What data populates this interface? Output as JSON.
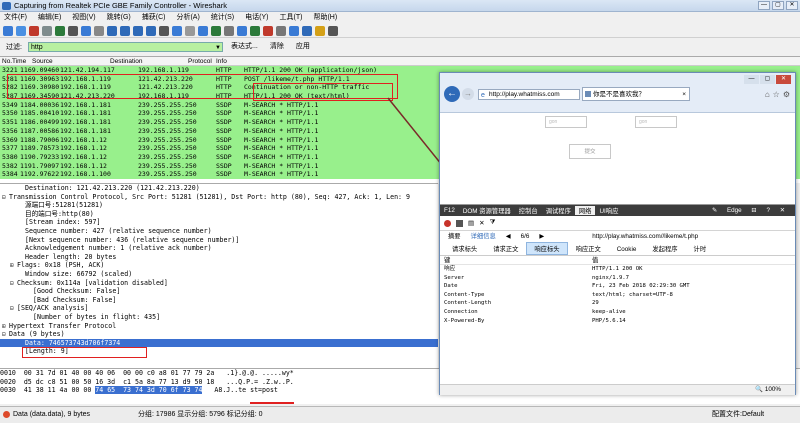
{
  "window": {
    "title": "Capturing from Realtek PCIe GBE Family Controller - Wireshark",
    "controls": [
      "—",
      "▢",
      "✕"
    ]
  },
  "menu": [
    "文件(F)",
    "编辑(E)",
    "视图(V)",
    "跳转(G)",
    "捕获(C)",
    "分析(A)",
    "统计(S)",
    "电话(Y)",
    "工具(T)",
    "帮助(H)"
  ],
  "filter": {
    "label": "过滤:",
    "value": "http",
    "buttons": [
      "表达式...",
      "清除",
      "应用"
    ]
  },
  "packet_list": {
    "headers": [
      "No.",
      "Time",
      "Source",
      "Destination",
      "Protocol",
      "Info"
    ],
    "rows": [
      {
        "no": "3221",
        "time": "1169.09460",
        "src": "121.42.194.117",
        "dst": "192.168.1.119",
        "proto": "HTTP",
        "info": "HTTP/1.1 200 OK  (application/json)",
        "bg": "#98f08c"
      },
      {
        "no": "5281",
        "time": "1169.30963",
        "src": "192.168.1.119",
        "dst": "121.42.213.220",
        "proto": "HTTP",
        "info": "POST /likeme/t.php HTTP/1.1",
        "bg": "#98f08c"
      },
      {
        "no": "5282",
        "time": "1169.30980",
        "src": "192.168.1.119",
        "dst": "121.42.213.220",
        "proto": "HTTP",
        "info": "Continuation or non-HTTP traffic",
        "bg": "#98f08c"
      },
      {
        "no": "5287",
        "time": "1169.34590",
        "src": "121.42.213.220",
        "dst": "192.168.1.119",
        "proto": "HTTP",
        "info": "HTTP/1.1 200 OK  (text/html)",
        "bg": "#98f08c"
      },
      {
        "no": "5349",
        "time": "1184.00036",
        "src": "192.168.1.181",
        "dst": "239.255.255.250",
        "proto": "SSDP",
        "info": "M-SEARCH * HTTP/1.1",
        "bg": "#98f08c"
      },
      {
        "no": "5350",
        "time": "1185.00410",
        "src": "192.168.1.181",
        "dst": "239.255.255.250",
        "proto": "SSDP",
        "info": "M-SEARCH * HTTP/1.1",
        "bg": "#98f08c"
      },
      {
        "no": "5351",
        "time": "1186.00499",
        "src": "192.168.1.181",
        "dst": "239.255.255.250",
        "proto": "SSDP",
        "info": "M-SEARCH * HTTP/1.1",
        "bg": "#98f08c"
      },
      {
        "no": "5356",
        "time": "1187.00586",
        "src": "192.168.1.181",
        "dst": "239.255.255.250",
        "proto": "SSDP",
        "info": "M-SEARCH * HTTP/1.1",
        "bg": "#98f08c"
      },
      {
        "no": "5369",
        "time": "1188.79006",
        "src": "192.168.1.12",
        "dst": "239.255.255.250",
        "proto": "SSDP",
        "info": "M-SEARCH * HTTP/1.1",
        "bg": "#98f08c"
      },
      {
        "no": "5377",
        "time": "1189.78573",
        "src": "192.168.1.12",
        "dst": "239.255.255.250",
        "proto": "SSDP",
        "info": "M-SEARCH * HTTP/1.1",
        "bg": "#98f08c"
      },
      {
        "no": "5380",
        "time": "1190.79233",
        "src": "192.168.1.12",
        "dst": "239.255.255.250",
        "proto": "SSDP",
        "info": "M-SEARCH * HTTP/1.1",
        "bg": "#98f08c"
      },
      {
        "no": "5382",
        "time": "1191.79097",
        "src": "192.168.1.12",
        "dst": "239.255.255.250",
        "proto": "SSDP",
        "info": "M-SEARCH * HTTP/1.1",
        "bg": "#98f08c"
      },
      {
        "no": "5384",
        "time": "1192.97622",
        "src": "192.168.1.100",
        "dst": "239.255.255.250",
        "proto": "SSDP",
        "info": "M-SEARCH * HTTP/1.1",
        "bg": "#98f08c"
      }
    ]
  },
  "details": [
    {
      "indent": 2,
      "tog": "",
      "text": "Destination: 121.42.213.220 (121.42.213.220)",
      "sel": false
    },
    {
      "indent": 0,
      "tog": "⊟",
      "text": "Transmission Control Protocol, Src Port: 51281 (51281), Dst Port: http (80), Seq: 427, Ack: 1, Len: 9",
      "sel": false
    },
    {
      "indent": 2,
      "tog": "",
      "text": "源端口号:51281(51281)",
      "sel": false
    },
    {
      "indent": 2,
      "tog": "",
      "text": "目的端口号:http(80)",
      "sel": false
    },
    {
      "indent": 2,
      "tog": "",
      "text": "[Stream index: 597]",
      "sel": false
    },
    {
      "indent": 2,
      "tog": "",
      "text": "Sequence number: 427    (relative sequence number)",
      "sel": false
    },
    {
      "indent": 2,
      "tog": "",
      "text": "[Next sequence number: 436    (relative sequence number)]",
      "sel": false
    },
    {
      "indent": 2,
      "tog": "",
      "text": "Acknowledgement number: 1    (relative ack number)",
      "sel": false
    },
    {
      "indent": 2,
      "tog": "",
      "text": "Header length: 20 bytes",
      "sel": false
    },
    {
      "indent": 1,
      "tog": "⊞",
      "text": "Flags: 0x18 (PSH, ACK)",
      "sel": false
    },
    {
      "indent": 2,
      "tog": "",
      "text": "Window size: 66792 (scaled)",
      "sel": false
    },
    {
      "indent": 1,
      "tog": "⊟",
      "text": "Checksum: 0x114a [validation disabled]",
      "sel": false
    },
    {
      "indent": 3,
      "tog": "",
      "text": "[Good Checksum: False]",
      "sel": false
    },
    {
      "indent": 3,
      "tog": "",
      "text": "[Bad Checksum: False]",
      "sel": false
    },
    {
      "indent": 1,
      "tog": "⊟",
      "text": "[SEQ/ACK analysis]",
      "sel": false
    },
    {
      "indent": 3,
      "tog": "",
      "text": "[Number of bytes in flight: 435]",
      "sel": false
    },
    {
      "indent": 0,
      "tog": "⊞",
      "text": "Hypertext Transfer Protocol",
      "sel": false
    },
    {
      "indent": 0,
      "tog": "⊟",
      "text": "Data (9 bytes)",
      "sel": false
    },
    {
      "indent": 2,
      "tog": "",
      "text": "Data: 746573743d706f7374",
      "sel": true
    },
    {
      "indent": 2,
      "tog": "",
      "text": "[Length: 9]",
      "sel": false
    }
  ],
  "bytes": [
    {
      "pre": "0010  00 31 7d 01 40 00 40 06  00 00 c0 a8 01 77 79 2a   .1}.@.@. .....wy*",
      "hl": "",
      "post": ""
    },
    {
      "pre": "0020  d5 dc c8 51 00 50 16 3d  c1 5a 8a 77 13 d9 50 18   ...Q.P.= .Z.w..P.",
      "hl": "",
      "post": ""
    },
    {
      "pre": "0030  41 38 11 4a 00 00 ",
      "hl": "74 65  73 74 3d 70 6f 73 74",
      "post": "   A8.J..te st=post"
    }
  ],
  "status": {
    "left": "Data (data.data), 9 bytes",
    "middle": "分组: 17986 显示分组: 5796 标记分组: 0",
    "right": "配置文件:Default"
  },
  "ie": {
    "address": "http://play.whatmiss.com",
    "tab_title": "你是不是喜欢我？",
    "controls": [
      "—",
      "▢",
      "✕"
    ],
    "page_inputs": [
      "gon",
      "gon"
    ],
    "page_button": "提交",
    "devtools": {
      "tabs": [
        "F12",
        "DOM 资源管理器",
        "控制台",
        "调试程序",
        "网络",
        "UI响应",
        "✎",
        "Edge",
        "⊟",
        "?",
        "✕"
      ],
      "active_tab": "网络",
      "toolbar": [
        "摘要",
        "详细信息",
        "6/6"
      ],
      "url": "http://play.whatmiss.com//likeme/t.php",
      "subtabs": [
        "请求标头",
        "请求正文",
        "响应标头",
        "响应正文",
        "Cookie",
        "发起程序",
        "计时"
      ],
      "active_subtab": "响应标头",
      "table_headers": [
        "键",
        "值"
      ],
      "rows": [
        {
          "k": "响应",
          "v": "HTTP/1.1 200 OK"
        },
        {
          "k": "Server",
          "v": "nginx/1.9.7"
        },
        {
          "k": "Date",
          "v": "Fri, 23 Feb 2018 02:29:30 GMT"
        },
        {
          "k": "Content-Type",
          "v": "text/html; charset=UTF-8"
        },
        {
          "k": "Content-Length",
          "v": "29"
        },
        {
          "k": "Connection",
          "v": "keep-alive"
        },
        {
          "k": "X-Powered-By",
          "v": "PHP/5.6.14"
        }
      ]
    },
    "zoom": "100%"
  }
}
